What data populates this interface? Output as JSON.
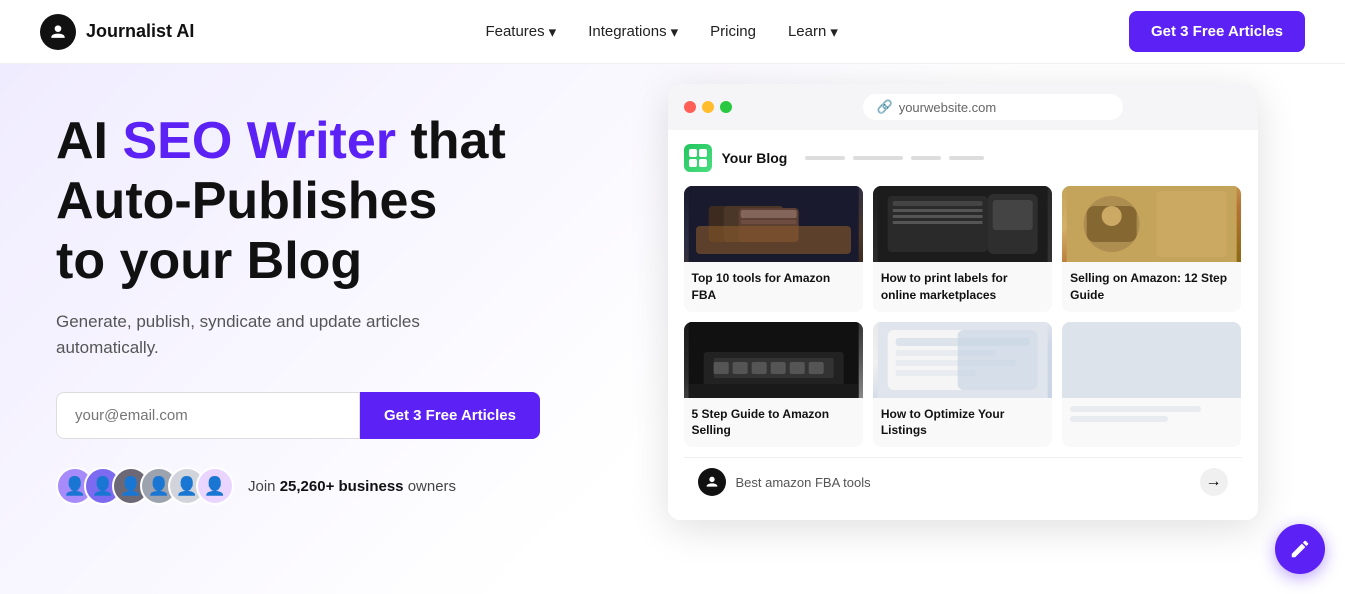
{
  "nav": {
    "logo_text": "Journalist AI",
    "links": [
      {
        "label": "Features",
        "has_dropdown": true
      },
      {
        "label": "Integrations",
        "has_dropdown": true
      },
      {
        "label": "Pricing",
        "has_dropdown": false
      },
      {
        "label": "Learn",
        "has_dropdown": true
      }
    ],
    "cta_label": "Get 3 Free Articles"
  },
  "hero": {
    "heading_plain": "AI ",
    "heading_highlight": "SEO Writer",
    "heading_rest": " that Auto-Publishes to your Blog",
    "subheading": "Generate, publish, syndicate and update articles automatically.",
    "email_placeholder": "your@email.com",
    "cta_label": "Get 3 Free Articles",
    "social_proof": "Join ",
    "social_proof_bold": "25,260+ business",
    "social_proof_end": " owners"
  },
  "browser": {
    "url": "yourwebsite.com",
    "blog_title": "Your Blog",
    "articles": [
      {
        "title": "Top 10 tools for Amazon FBA",
        "img_type": "brown"
      },
      {
        "title": "How to print labels for online marketplaces",
        "img_type": "print"
      },
      {
        "title": "Selling on Amazon: 12 Step Guide",
        "img_type": "delivery"
      },
      {
        "title": "5 Step Guide to Amazon Selling",
        "img_type": "laptop"
      },
      {
        "title": "How to Optimize Your Listings",
        "img_type": "screen"
      },
      {
        "title": "",
        "img_type": "blank"
      }
    ],
    "chat_placeholder": "Best amazon FBA tools"
  },
  "icons": {
    "link_icon": "🔗",
    "send_icon": "→",
    "chat_icon": "✏️"
  }
}
